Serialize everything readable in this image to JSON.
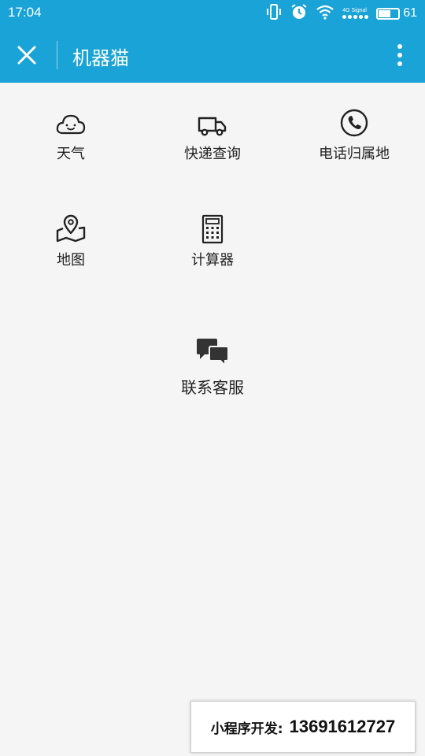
{
  "status_bar": {
    "time": "17:04",
    "signal_label": "4G Signal",
    "battery_level": 61,
    "battery_text": "61"
  },
  "navbar": {
    "title": "机器猫",
    "background": "#1aa3d6"
  },
  "tiles": [
    {
      "label": "天气",
      "icon": "cloud-icon"
    },
    {
      "label": "快递查询",
      "icon": "truck-icon"
    },
    {
      "label": "电话归属地",
      "icon": "phone-icon"
    },
    {
      "label": "地图",
      "icon": "map-pin-icon"
    },
    {
      "label": "计算器",
      "icon": "calculator-icon"
    }
  ],
  "contact": {
    "label": "联系客服",
    "icon": "chat-bubbles-icon"
  },
  "promo": {
    "key": "小程序开发:",
    "value": "13691612727"
  }
}
